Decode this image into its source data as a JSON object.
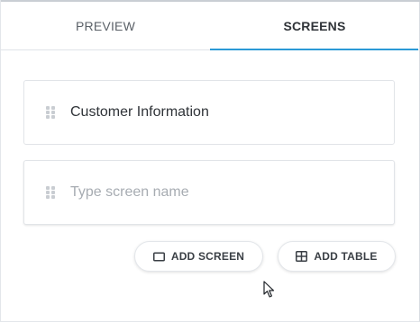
{
  "tabs": [
    {
      "label": "PREVIEW",
      "active": false
    },
    {
      "label": "SCREENS",
      "active": true
    }
  ],
  "screens": {
    "items": [
      {
        "name": "Customer Information"
      }
    ],
    "new_screen_input": {
      "value": "",
      "placeholder": "Type screen name"
    }
  },
  "actions": {
    "add_screen_label": "ADD SCREEN",
    "add_screen_icon": "rectangle-icon",
    "add_table_label": "ADD TABLE",
    "add_table_icon": "table-grid-icon"
  },
  "colors": {
    "accent": "#2b9ad6",
    "text": "#2f3338",
    "placeholder": "#a7acb2",
    "border": "#e1e4e8"
  }
}
